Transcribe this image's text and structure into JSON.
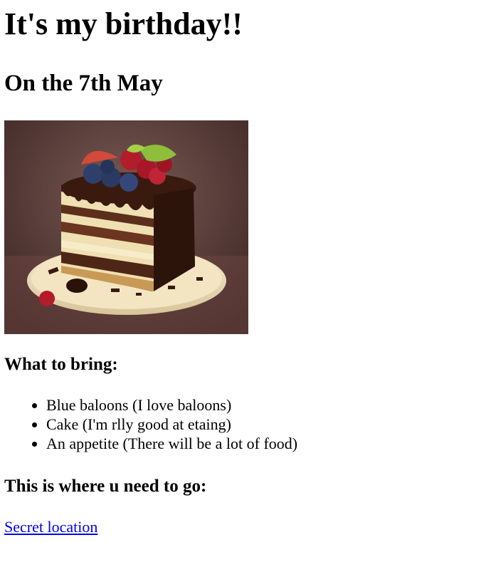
{
  "heading": "It's my birthday!!",
  "date_heading": "On the 7th May",
  "cake_image": {
    "icon": "chocolate-cake-slice-icon",
    "colors": {
      "background": "#5a3c3a",
      "plate": "#f1e2bf",
      "chocolate": "#3b1d12",
      "cream": "#f4e4b8",
      "blueberry": "#2e3f6b",
      "raspberry": "#b31c2b"
    }
  },
  "bring": {
    "title": "What to bring:",
    "items": [
      "Blue baloons (I love baloons)",
      "Cake (I'm rlly good at etaing)",
      "An appetite (There will be a lot of food)"
    ]
  },
  "location": {
    "title": "This is where u need to go:",
    "link_text": "Secret location",
    "link_color": "#0000ee"
  }
}
